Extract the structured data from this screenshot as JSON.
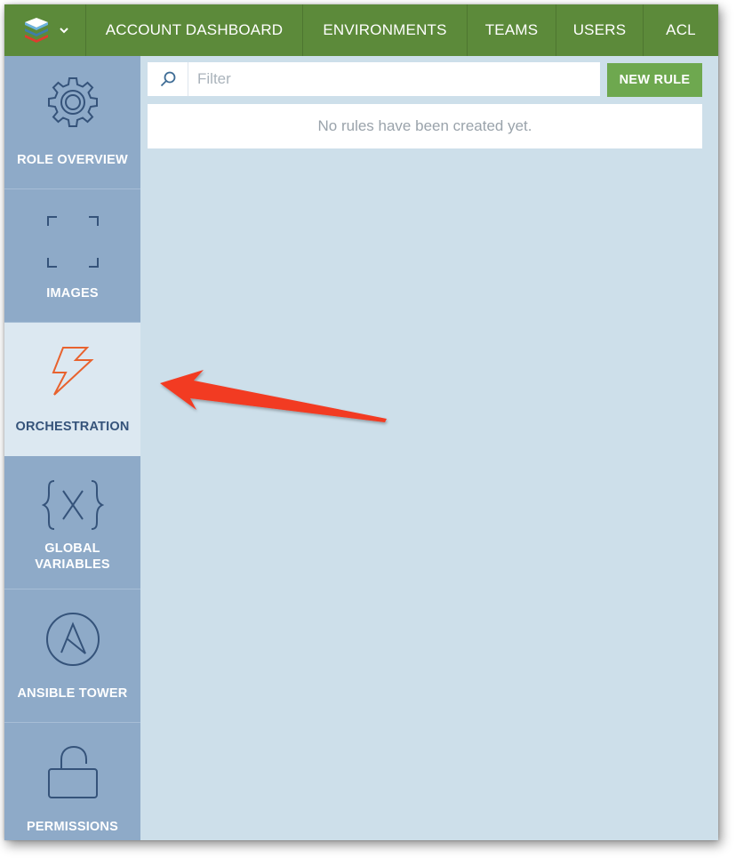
{
  "topbar": {
    "nav": [
      {
        "label": "ACCOUNT DASHBOARD"
      },
      {
        "label": "ENVIRONMENTS"
      },
      {
        "label": "TEAMS"
      },
      {
        "label": "USERS"
      },
      {
        "label": "ACL"
      }
    ]
  },
  "sidebar": {
    "active": "ORCHESTRATION",
    "items": [
      {
        "icon": "gear-icon",
        "label": "ROLE OVERVIEW"
      },
      {
        "icon": "image-frame-icon",
        "label": "IMAGES"
      },
      {
        "icon": "lightning-bolt-icon",
        "label": "ORCHESTRATION"
      },
      {
        "icon": "variable-braces-icon",
        "label_line1": "GLOBAL",
        "label_line2": "VARIABLES"
      },
      {
        "icon": "ansible-logo-icon",
        "label": "ANSIBLE TOWER"
      },
      {
        "icon": "padlock-icon",
        "label": "PERMISSIONS"
      }
    ]
  },
  "main": {
    "filter": {
      "placeholder": "Filter",
      "value": ""
    },
    "new_rule_label": "NEW RULE",
    "empty_message": "No rules have been created yet."
  },
  "colors": {
    "topbar": "#5c8a3a",
    "sidebar": "#8eaac8",
    "sidebar_active": "#dce8f1",
    "content_bg": "#cddfea",
    "button_green": "#6ea84f",
    "accent_orange": "#e8622e",
    "annotation_arrow": "#f23a22"
  }
}
